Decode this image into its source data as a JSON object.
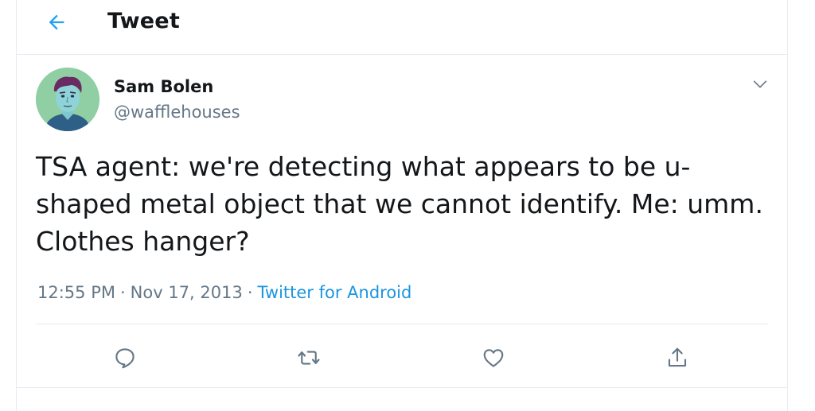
{
  "header": {
    "title": "Tweet",
    "back_icon": "arrow-left-icon"
  },
  "tweet": {
    "author": {
      "display_name": "Sam Bolen",
      "handle": "@wafflehouses"
    },
    "text": "TSA agent: we're detecting what appears to be u-\nshaped metal object that we cannot identify. Me: umm.\nClothes hanger?",
    "time": "12:55 PM",
    "date": "Nov 17, 2013",
    "separator": "·",
    "source": "Twitter for Android"
  },
  "actions": [
    {
      "name": "reply",
      "icon": "reply-icon"
    },
    {
      "name": "retweet",
      "icon": "retweet-icon"
    },
    {
      "name": "like",
      "icon": "heart-icon"
    },
    {
      "name": "share",
      "icon": "share-icon"
    }
  ],
  "colors": {
    "accent": "#1da1f2",
    "link": "#1b95e0",
    "secondary_text": "#657786",
    "icon_gray": "#657786",
    "border": "#e6ecf0"
  }
}
